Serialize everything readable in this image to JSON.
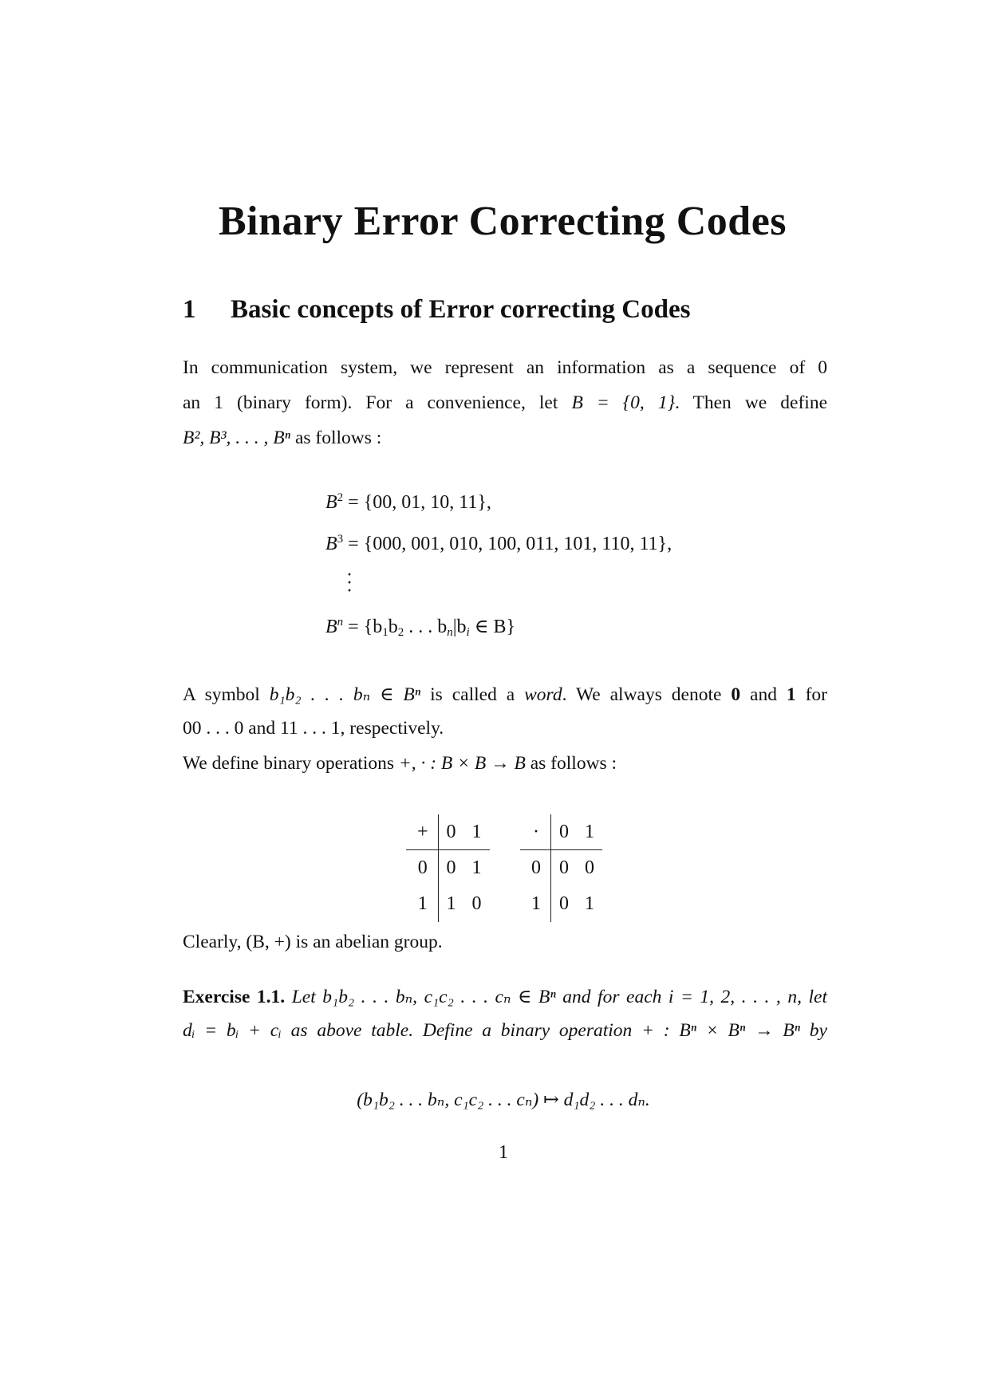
{
  "document": {
    "title": "Binary Error Correcting Codes",
    "section": {
      "number": "1",
      "title": "Basic concepts of Error correcting Codes"
    },
    "paragraph1": {
      "line1": "In communication system, we represent an information as a sequence of 0",
      "line2_prefix": "an 1 (binary form).  For a convenience, let ",
      "line2_math": "B = {0, 1}",
      "line2_suffix": ".  Then we define",
      "line3_math": "B², B³, . . . , Bⁿ",
      "line3_suffix": " as follows :"
    },
    "equations": [
      {
        "lhs": "B",
        "exp": "2",
        "rhs": " = {00, 01, 10, 11},"
      },
      {
        "lhs": "B",
        "exp": "3",
        "rhs": " = {000, 001, 010, 100, 011, 101, 110, 11},"
      },
      {
        "lhs": "B",
        "exp": "n",
        "rhs_a": " = {b",
        "rhs_b": "b",
        "rhs_c": " . . . b",
        "rhs_d": "|b",
        "rhs_e": " ∈ B}"
      }
    ],
    "vdots": "⋮",
    "paragraph2": {
      "line1_a": "A symbol ",
      "line1_math": "b₁b₂ . . . bₙ ∈ Bⁿ",
      "line1_b": " is called a ",
      "line1_word": "word",
      "line1_c": ".  We always denote ",
      "bold0": "0",
      "line1_d": " and ",
      "bold1": "1",
      "line1_e": " for",
      "line2": "00 . . . 0 and 11 . . . 1, respectively.",
      "line3_a": "We define binary operations ",
      "line3_math": "+, · : B × B → B",
      "line3_b": " as follows :"
    },
    "tables": [
      {
        "operator": "+",
        "columns": [
          "0",
          "1"
        ],
        "rows": [
          {
            "header": "0",
            "cells": [
              "0",
              "1"
            ]
          },
          {
            "header": "1",
            "cells": [
              "1",
              "0"
            ]
          }
        ]
      },
      {
        "operator": "·",
        "columns": [
          "0",
          "1"
        ],
        "rows": [
          {
            "header": "0",
            "cells": [
              "0",
              "0"
            ]
          },
          {
            "header": "1",
            "cells": [
              "0",
              "1"
            ]
          }
        ]
      }
    ],
    "paragraph3": "Clearly, (B, +) is an abelian group.",
    "exercise": {
      "label": "Exercise 1.1.",
      "line1": " Let b₁b₂ . . . bₙ, c₁c₂ . . . cₙ ∈ Bⁿ and for each i = 1, 2, . . . , n, let",
      "line2": "dᵢ = bᵢ + cᵢ as above table. Define a binary operation + : Bⁿ × Bⁿ → Bⁿ by",
      "display": "(b₁b₂ . . . bₙ, c₁c₂ . . . cₙ) ↦ d₁d₂ . . . dₙ."
    },
    "page_number": "1"
  }
}
